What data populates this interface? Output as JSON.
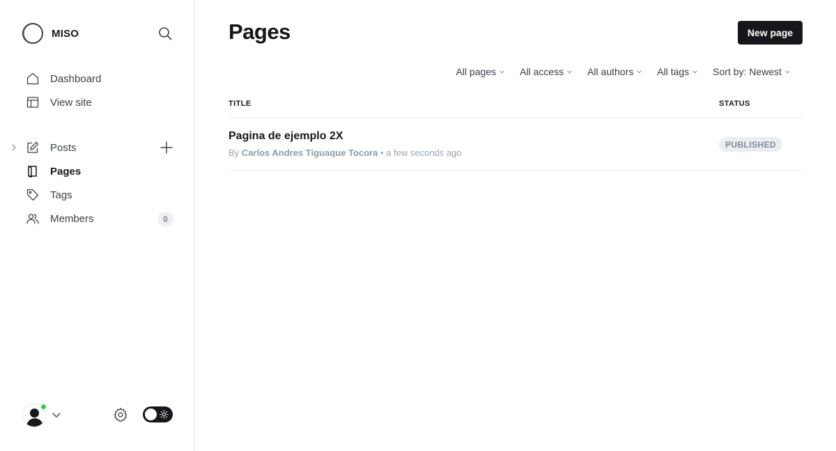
{
  "brand": {
    "name": "MISO"
  },
  "sidebar": {
    "top_items": [
      {
        "label": "Dashboard",
        "icon": "home-icon"
      },
      {
        "label": "View site",
        "icon": "layout-icon"
      }
    ],
    "main_items": [
      {
        "label": "Posts",
        "icon": "edit-icon"
      },
      {
        "label": "Pages",
        "icon": "page-icon",
        "active": true
      },
      {
        "label": "Tags",
        "icon": "tag-icon"
      },
      {
        "label": "Members",
        "icon": "members-icon",
        "count": "0"
      }
    ]
  },
  "header": {
    "title": "Pages",
    "new_button": "New page"
  },
  "filters": [
    "All pages",
    "All access",
    "All authors",
    "All tags",
    "Sort by: Newest"
  ],
  "table": {
    "columns": {
      "title": "TITLE",
      "status": "STATUS"
    },
    "rows": [
      {
        "title": "Pagina de ejemplo 2X",
        "by": "By",
        "author": "Carlos Andres Tiguaque Tocora",
        "separator": "•",
        "time": "a few seconds ago",
        "status": "PUBLISHED"
      }
    ]
  },
  "colors": {
    "accent": "#15171a",
    "online": "#30cf43",
    "badge_bg": "#ebeef0",
    "muted_text": "#99a3ad"
  }
}
